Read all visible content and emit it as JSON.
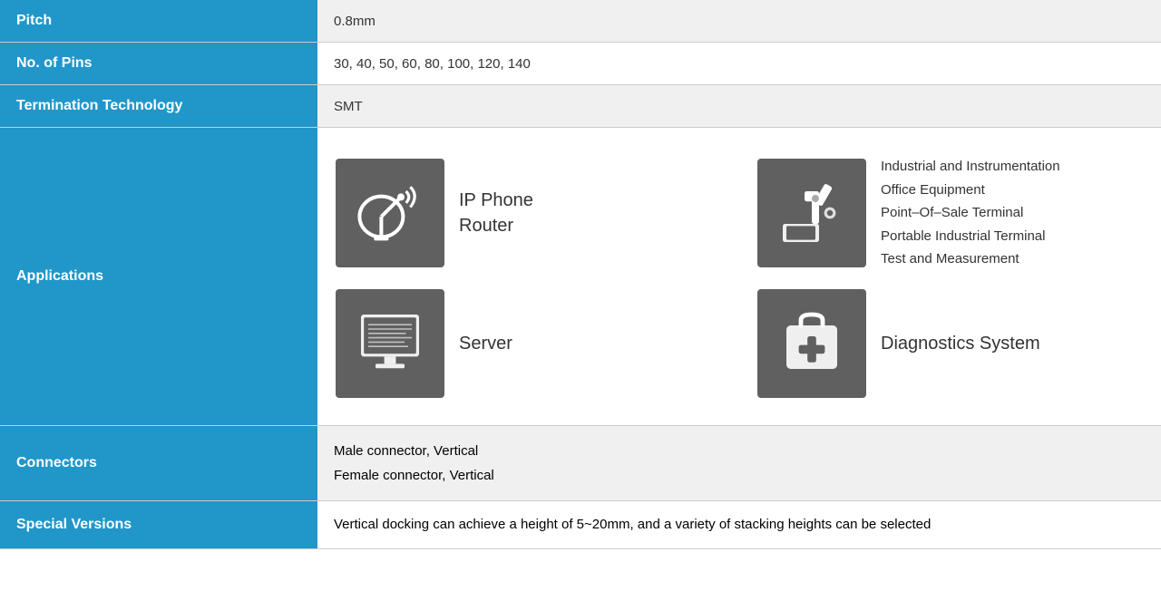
{
  "rows": {
    "pitch": {
      "label": "Pitch",
      "value": "0.8mm"
    },
    "no_of_pins": {
      "label": "No. of Pins",
      "value": "30, 40, 50, 60, 80, 100, 120, 140"
    },
    "termination_technology": {
      "label": "Termination Technology",
      "value": "SMT"
    },
    "applications": {
      "label": "Applications",
      "items": [
        {
          "icon": "satellite-dish",
          "label": "IP Phone\nRouter"
        },
        {
          "icon": "industrial",
          "label": "Industrial and Instrumentation\nOffice Equipment\nPoint–Of–Sale Terminal\nPortable Industrial Terminal\nTest and Measurement"
        },
        {
          "icon": "server",
          "label": "Server"
        },
        {
          "icon": "diagnostics",
          "label": "Diagnostics System"
        }
      ]
    },
    "connectors": {
      "label": "Connectors",
      "value": "Male connector, Vertical\nFemale connector, Vertical"
    },
    "special_versions": {
      "label": "Special Versions",
      "value": "Vertical docking can achieve a height of 5~20mm, and a variety of stacking heights can be selected"
    }
  }
}
